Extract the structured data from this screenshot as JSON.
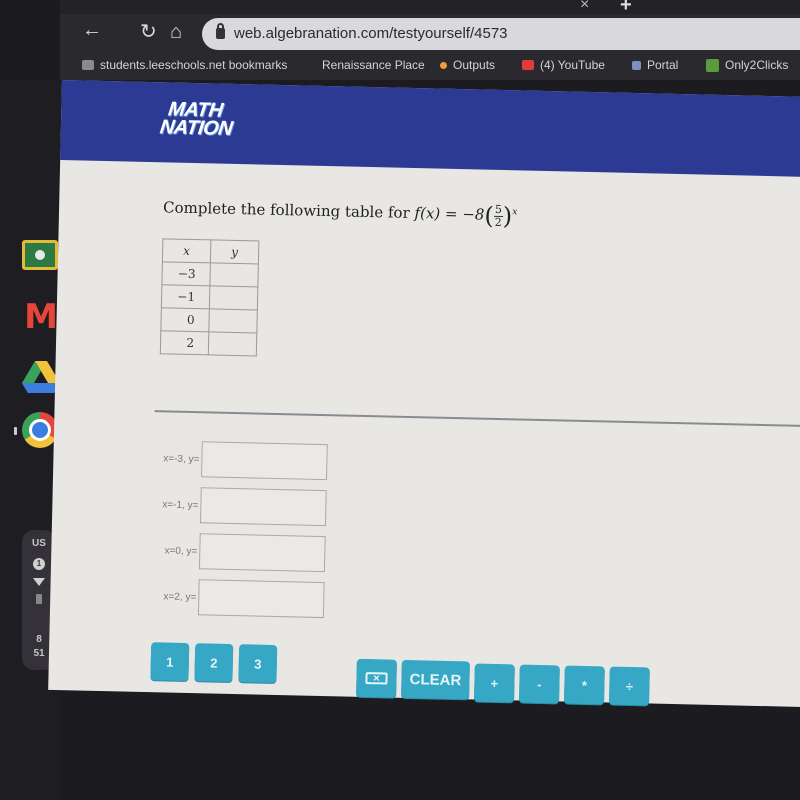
{
  "browser": {
    "url": "web.algebranation.com/testyourself/4573",
    "tab_close": "×",
    "tab_new": "+",
    "nav": {
      "back": "←",
      "reload": "↻",
      "home": "⌂"
    },
    "bookmarks": [
      {
        "label": "students.leeschools.net bookmarks",
        "icon": "folder-icon"
      },
      {
        "label": "Renaissance Place",
        "icon": "none"
      },
      {
        "label": "Outputs",
        "icon": "dot-icon"
      },
      {
        "label": "(4) YouTube",
        "icon": "youtube-icon"
      },
      {
        "label": "Portal",
        "icon": "portal-icon"
      },
      {
        "label": "Only2Clicks",
        "icon": "only2clicks-icon"
      }
    ]
  },
  "shelf": {
    "apps": [
      "google-classroom-icon",
      "gmail-icon",
      "google-drive-icon",
      "chrome-icon"
    ],
    "tray": {
      "locale": "US",
      "notification_count": "1",
      "battery_top": "8",
      "battery_bottom": "51"
    }
  },
  "header": {
    "logo_line1": "MATH",
    "logo_line2": "NATION"
  },
  "question": {
    "prompt": "Complete the following table for",
    "function_lhs": "f(x) = −8",
    "base_numerator": "5",
    "base_denominator": "2",
    "exponent": "x"
  },
  "table": {
    "headers": [
      "x",
      "y"
    ],
    "rows": [
      {
        "x": "−3",
        "y": ""
      },
      {
        "x": "−1",
        "y": ""
      },
      {
        "x": "0",
        "y": ""
      },
      {
        "x": "2",
        "y": ""
      }
    ]
  },
  "answers": [
    {
      "label": "x=-3, y=",
      "value": "",
      "placeholder": ""
    },
    {
      "label": "x=-1, y=",
      "value": "",
      "placeholder": ""
    },
    {
      "label": "x=0, y=",
      "value": "",
      "placeholder": ""
    },
    {
      "label": "x=2, y=",
      "value": "",
      "placeholder": ""
    }
  ],
  "keypad": {
    "numbers": [
      "1",
      "2",
      "3"
    ],
    "backspace_glyph": "✕",
    "clear": "CLEAR",
    "operators": [
      "+",
      "-",
      "*",
      "÷"
    ],
    "color": "#36a8c6"
  },
  "colors": {
    "header": "#2c3a94",
    "page_bg": "#e9e7e4"
  }
}
